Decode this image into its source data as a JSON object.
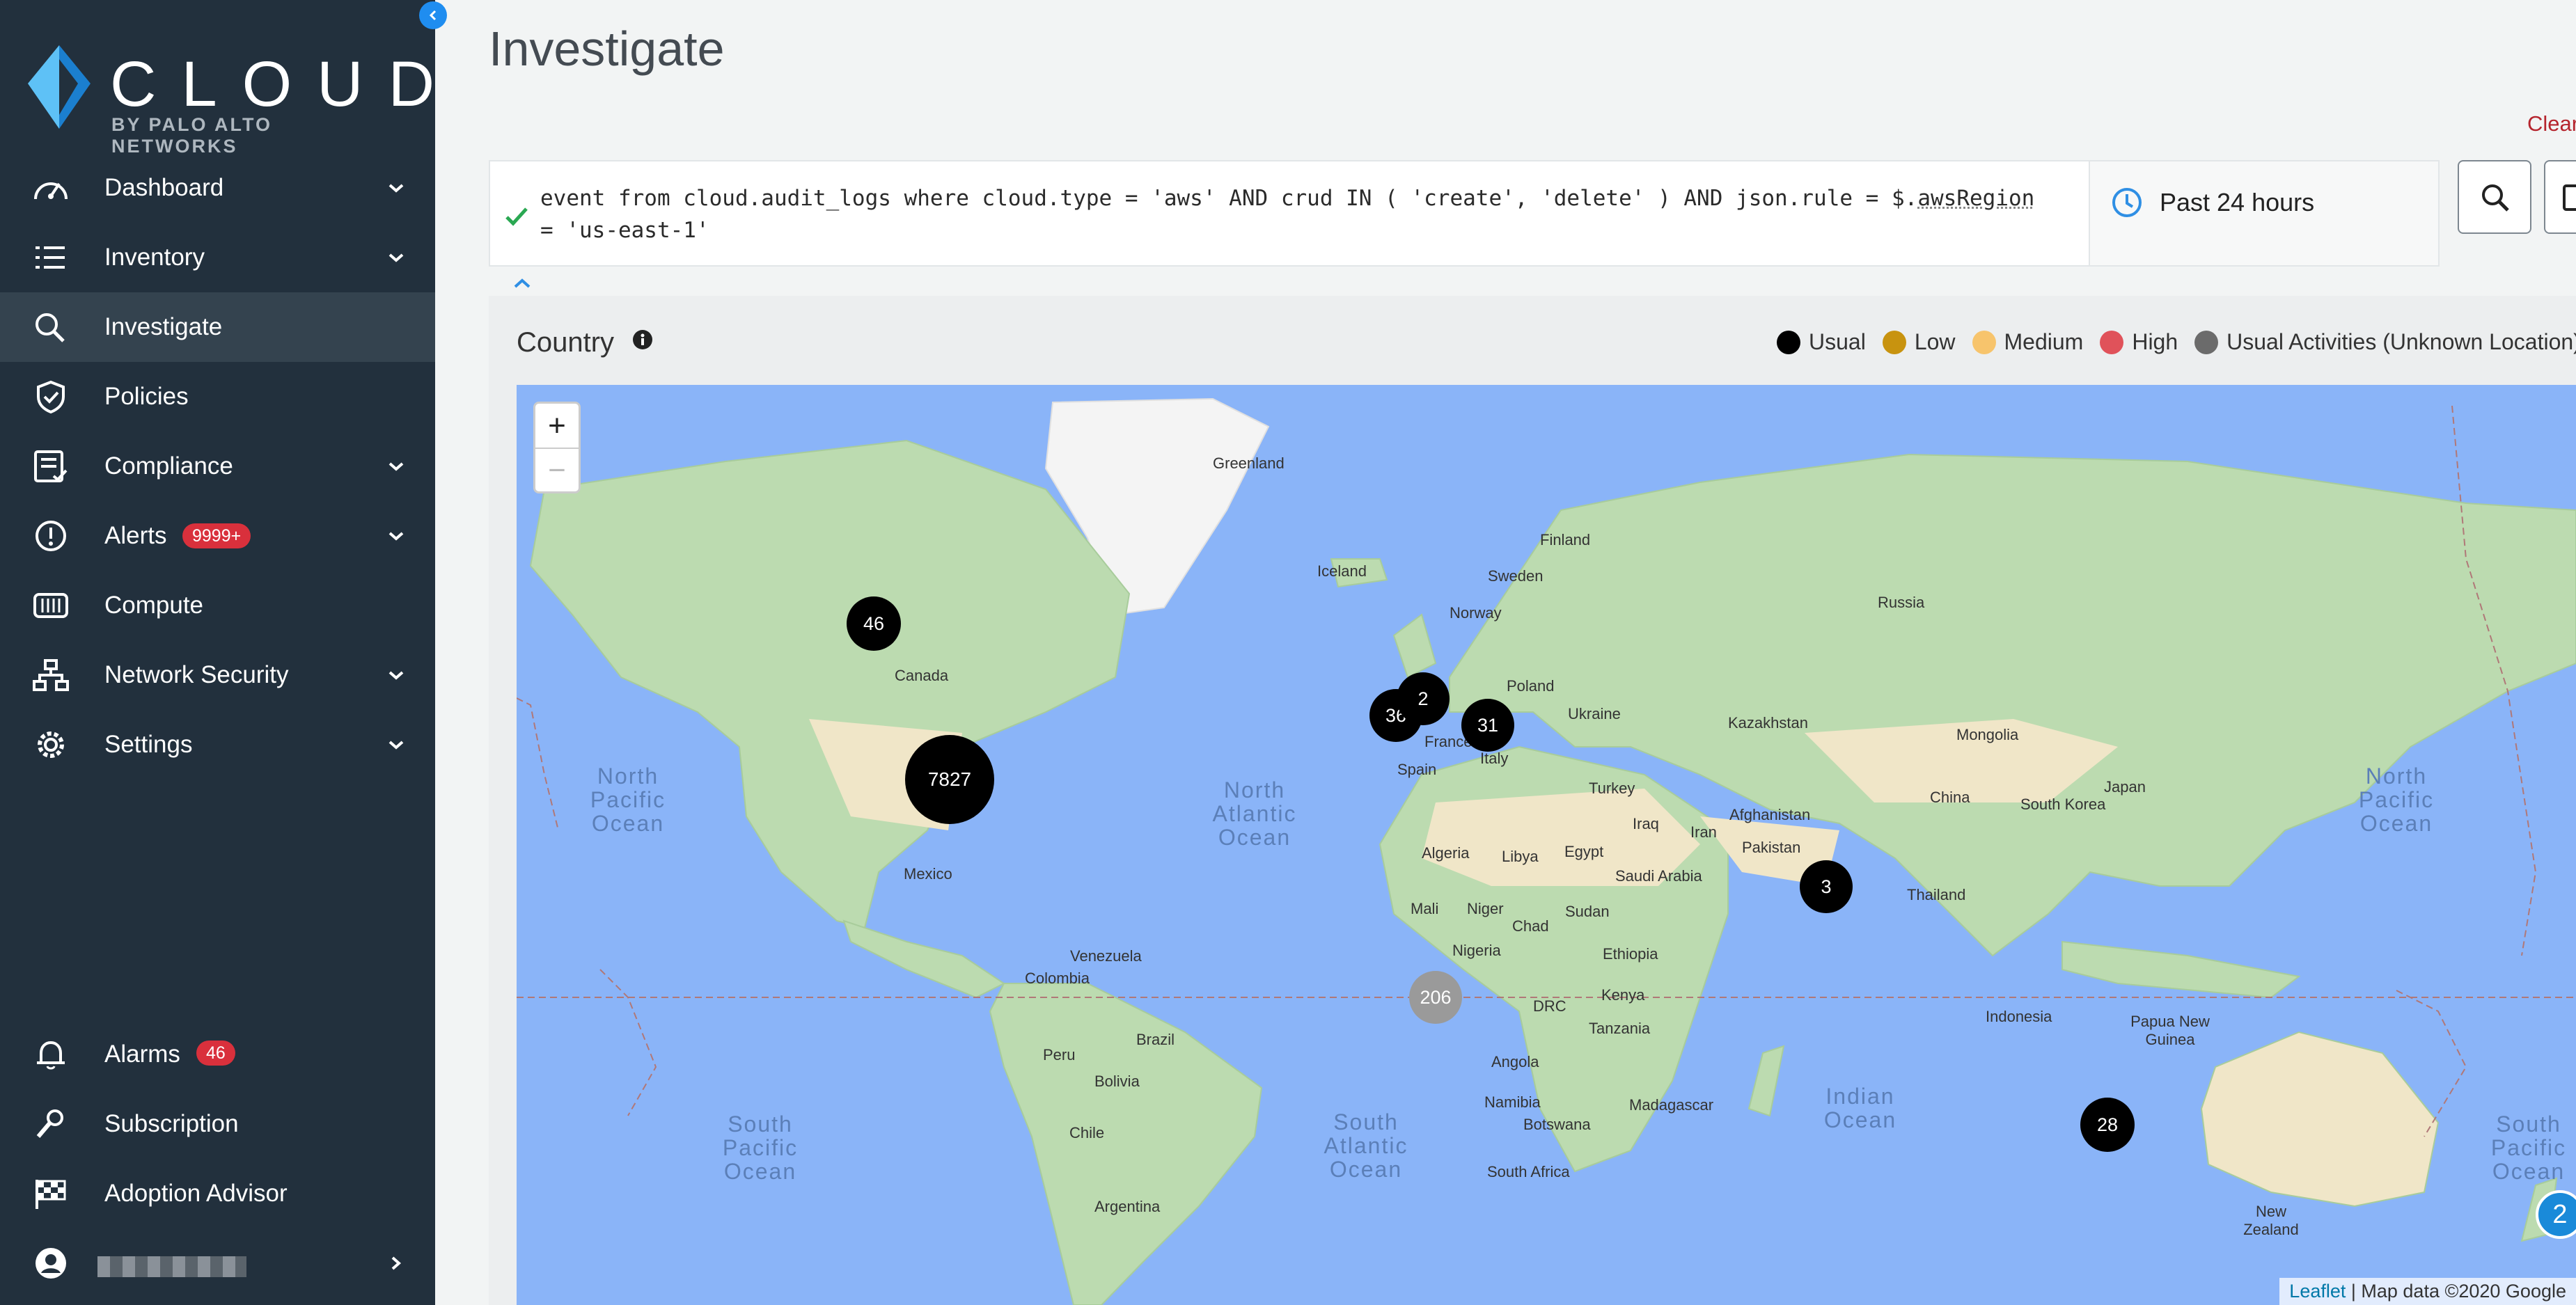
{
  "brand": {
    "name": "CLOUD",
    "tagline": "BY PALO ALTO NETWORKS",
    "accent": "#3fa9f5"
  },
  "sidebar": {
    "items": [
      {
        "label": "Dashboard",
        "icon": "gauge-icon",
        "expandable": true
      },
      {
        "label": "Inventory",
        "icon": "list-icon",
        "expandable": true
      },
      {
        "label": "Investigate",
        "icon": "search-icon",
        "expandable": false,
        "active": true
      },
      {
        "label": "Policies",
        "icon": "shield-check-icon",
        "expandable": false
      },
      {
        "label": "Compliance",
        "icon": "checklist-icon",
        "expandable": true
      },
      {
        "label": "Alerts",
        "icon": "alert-icon",
        "expandable": true,
        "badge": "9999+"
      },
      {
        "label": "Compute",
        "icon": "compute-icon",
        "expandable": false
      },
      {
        "label": "Network Security",
        "icon": "network-icon",
        "expandable": true
      },
      {
        "label": "Settings",
        "icon": "gear-icon",
        "expandable": true
      }
    ],
    "bottom_items": [
      {
        "label": "Alarms",
        "icon": "bell-icon",
        "badge": "46"
      },
      {
        "label": "Subscription",
        "icon": "wrench-icon"
      },
      {
        "label": "Adoption Advisor",
        "icon": "flag-icon"
      }
    ]
  },
  "header": {
    "title": "Investigate",
    "clear_label": "Clear"
  },
  "query": {
    "text": "event from cloud.audit_logs where cloud.type = 'aws' AND crud IN ( 'create', 'delete' ) AND json.rule = $.",
    "var": "awsRegion",
    "text_end": " = 'us-east-1'",
    "status": "valid",
    "time_range": "Past 24 hours"
  },
  "panel": {
    "title": "Country",
    "legend": [
      {
        "label": "Usual",
        "color": "#000000"
      },
      {
        "label": "Low",
        "color": "#c8930f"
      },
      {
        "label": "Medium",
        "color": "#f7c46c"
      },
      {
        "label": "High",
        "color": "#e0525a"
      },
      {
        "label": "Usual Activities (Unknown Location)",
        "color": "#6b6b6b"
      }
    ]
  },
  "map": {
    "zoom_in": "+",
    "zoom_out": "−",
    "attribution_link": "Leaflet",
    "attribution_text": " | Map data ©2020 Google",
    "clusters": [
      {
        "count": "7827",
        "region": "United States",
        "level": "usual"
      },
      {
        "count": "46",
        "region": "Canada",
        "level": "usual"
      },
      {
        "count": "36",
        "region": "Ireland",
        "level": "usual"
      },
      {
        "count": "2",
        "region": "United Kingdom",
        "level": "usual"
      },
      {
        "count": "31",
        "region": "Germany",
        "level": "usual"
      },
      {
        "count": "3",
        "region": "India",
        "level": "usual"
      },
      {
        "count": "28",
        "region": "Australia",
        "level": "usual"
      },
      {
        "count": "206",
        "region": "Unknown",
        "level": "unknown"
      }
    ],
    "labels": {
      "greenland": "Greenland",
      "iceland": "Iceland",
      "finland": "Finland",
      "sweden": "Sweden",
      "norway": "Norway",
      "russia": "Russia",
      "canada": "Canada",
      "ukraine": "Ukraine",
      "poland": "Poland",
      "kazakhstan": "Kazakhstan",
      "mongolia": "Mongolia",
      "france": "France",
      "italy": "Italy",
      "spain": "Spain",
      "turkey": "Turkey",
      "china": "China",
      "south_korea": "South Korea",
      "japan": "Japan",
      "iraq": "Iraq",
      "iran": "Iran",
      "afghanistan": "Afghanistan",
      "pakistan": "Pakistan",
      "algeria": "Algeria",
      "libya": "Libya",
      "egypt": "Egypt",
      "saudi_arabia": "Saudi Arabia",
      "mexico": "Mexico",
      "mali": "Mali",
      "niger": "Niger",
      "sudan": "Sudan",
      "chad": "Chad",
      "thailand": "Thailand",
      "nigeria": "Nigeria",
      "ethiopia": "Ethiopia",
      "venezuela": "Venezuela",
      "colombia": "Colombia",
      "kenya": "Kenya",
      "drc": "DRC",
      "tanzania": "Tanzania",
      "indonesia": "Indonesia",
      "papua": "Papua New Guinea",
      "peru": "Peru",
      "brazil": "Brazil",
      "bolivia": "Bolivia",
      "angola": "Angola",
      "namibia": "Namibia",
      "botswana": "Botswana",
      "madagascar": "Madagascar",
      "chile": "Chile",
      "south_africa": "South Africa",
      "argentina": "Argentina",
      "new_zealand": "New Zealand"
    },
    "oceans": {
      "north_pacific": "North Pacific Ocean",
      "north_atlantic": "North Atlantic Ocean",
      "south_pacific": "South Pacific Ocean",
      "south_atlantic": "South Atlantic Ocean",
      "indian": "Indian Ocean",
      "south_pacific_right": "South Pacific Ocean",
      "north_pacific_right": "North Pacific Ocean"
    }
  },
  "help": {
    "count": "2"
  }
}
